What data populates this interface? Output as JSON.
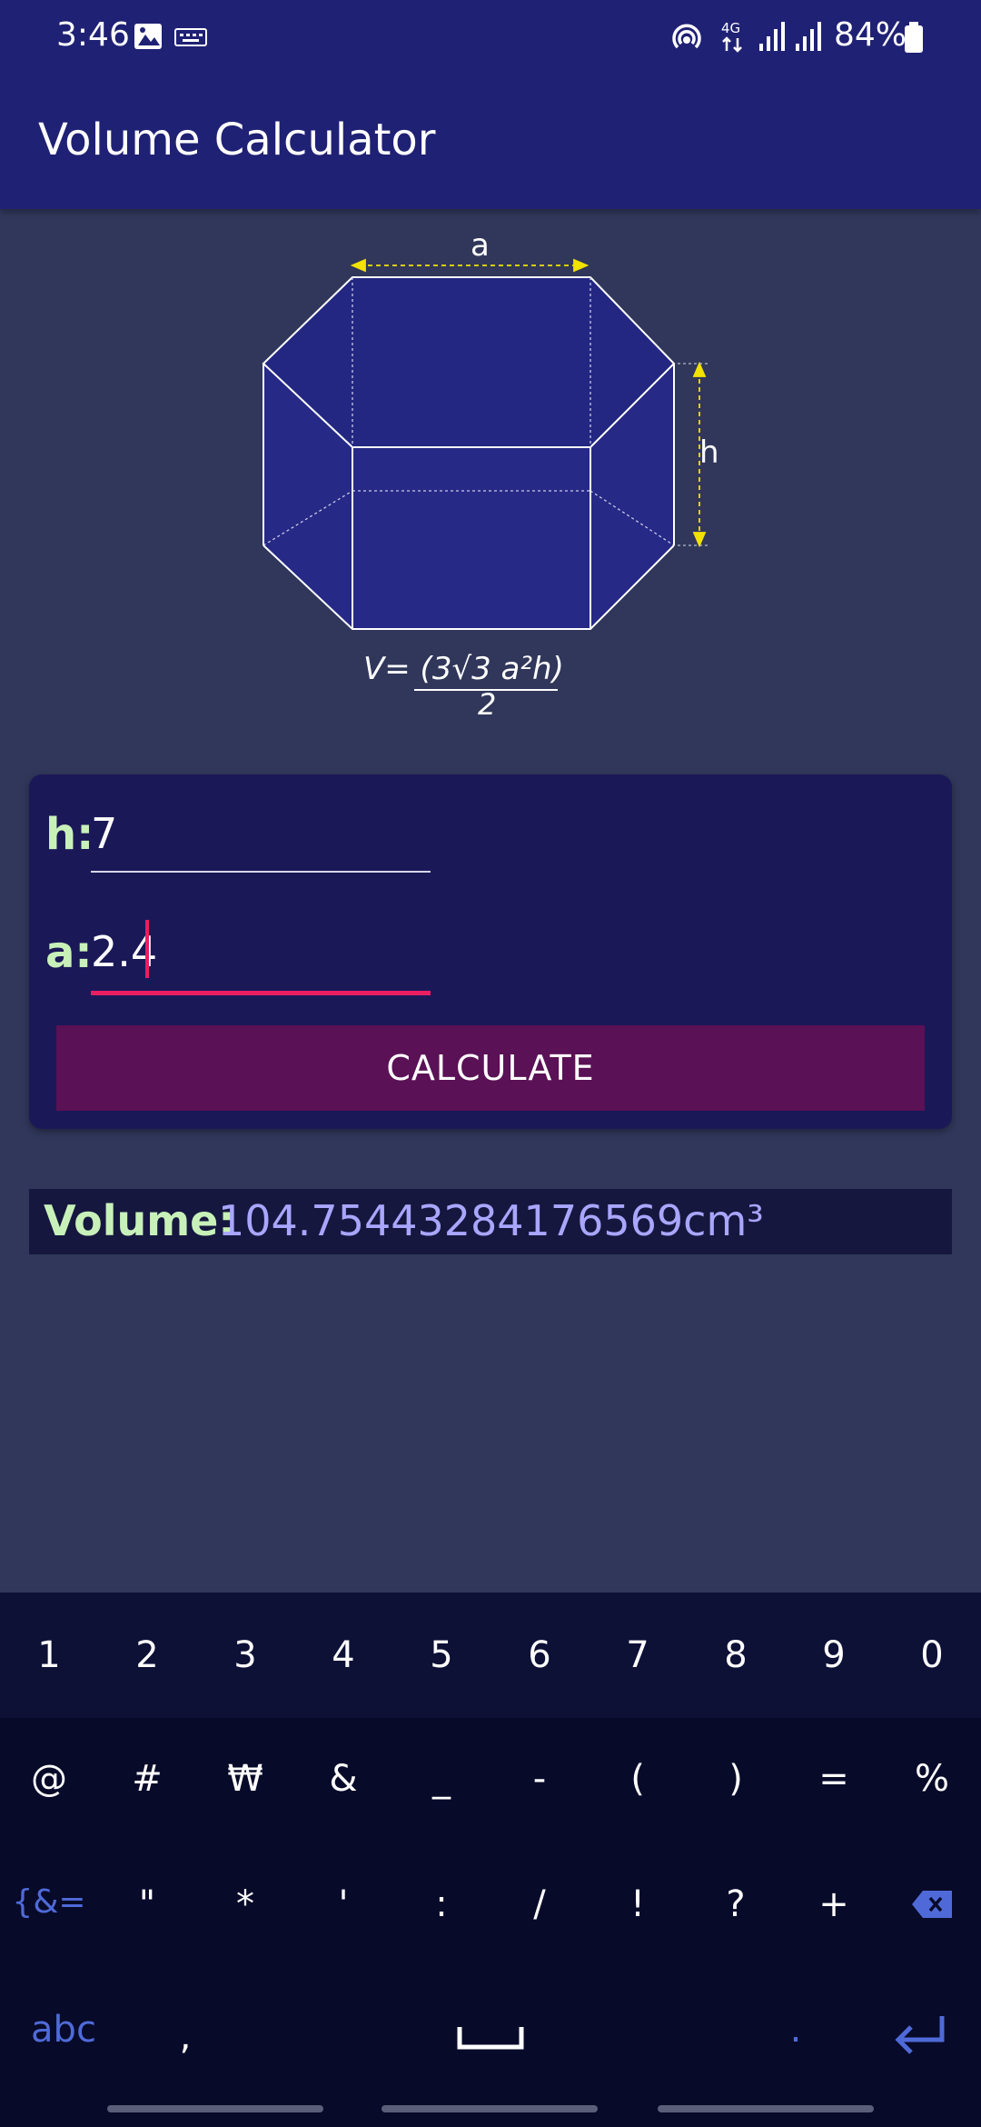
{
  "status_bar": {
    "time": "3:46",
    "battery": "84%",
    "icons": [
      "image-icon",
      "keyboard-icon",
      "hotspot-icon",
      "4g-icon",
      "signal-icon",
      "signal-icon",
      "battery-icon"
    ]
  },
  "app_bar": {
    "title": "Volume Calculator"
  },
  "diagram": {
    "label_a": "a",
    "label_h": "h",
    "formula_numerator": "V= (3√3 a²h)",
    "formula_denominator": "2"
  },
  "form": {
    "h_label": "h:",
    "h_value": "7",
    "a_label": "a:",
    "a_value": "2.4",
    "calculate_label": "CALCULATE"
  },
  "result": {
    "label": "Volume:",
    "value": "104.75443284176569cm³"
  },
  "keyboard": {
    "number_row": [
      "1",
      "2",
      "3",
      "4",
      "5",
      "6",
      "7",
      "8",
      "9",
      "0"
    ],
    "symbol_row1": [
      "@",
      "#",
      "₩",
      "&",
      "_",
      "-",
      "(",
      ")",
      "=",
      "%"
    ],
    "symbol_row2": [
      "{&=",
      "\"",
      "*",
      "'",
      ":",
      "/",
      "!",
      "?",
      "+"
    ],
    "bottom_row": {
      "abc": "abc",
      "comma": ",",
      "period": "."
    }
  },
  "colors": {
    "app_bar": "#1f2174",
    "background": "#30375a",
    "card": "#1b1858",
    "accent": "#e91e63",
    "button": "#5a1155",
    "label_green": "#c8f1b9",
    "result_value": "#a9a6ff"
  }
}
